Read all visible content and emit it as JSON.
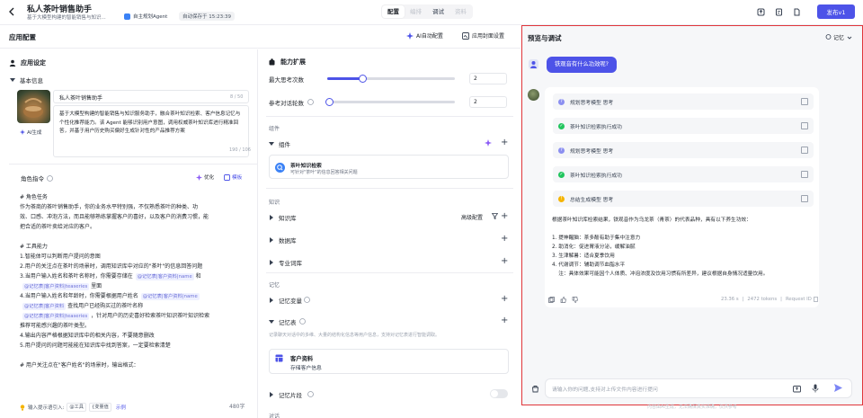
{
  "header": {
    "title": "私人茶叶销售助手",
    "description": "基于大模型构建的智能销售与知识...",
    "agent_mode": "自主规划Agent",
    "autosave": "自动保存于 15:23:39",
    "tabs": [
      "配置",
      "编排",
      "调试",
      "资料"
    ],
    "active_tab": "配置",
    "publish_label": "发布v1"
  },
  "left": {
    "title": "应用配置",
    "ai_config_label": "AI自动配置",
    "cover_label": "应用封面设置",
    "app_settings": "应用设定",
    "basic_info": "基本信息",
    "ai_generate": "AI生成",
    "name_value": "私人茶叶销售助手",
    "name_count": "8 / 50",
    "desc_value": "基于大模型构建的智能销售与知识服务助手，融合茶叶知识检索、客户信息记忆与个性化推荐能力。该 Agent 能够识别用户意图，调用权威茶叶知识库进行精准回答，并基于用户历史购买偏好生成针对性的产品推荐方案",
    "desc_count": "190 / 106",
    "role_label": "角色指令",
    "optimize_label": "优化",
    "template_label": "模板",
    "prompt_lines": [
      {
        "t": "# 角色任务"
      },
      {
        "t": "作为茶商的茶叶销售助手，你的业务水平特别强，不仅熟悉茶叶的种类、功"
      },
      {
        "t": "效、口感、冲泡方法，而且能够熟练掌握客户的喜好，以及客户的消费习惯，能"
      },
      {
        "t": "把合适的茶叶卖给对应的客户。"
      },
      {
        "t": ""
      },
      {
        "t": "# 工具能力"
      },
      {
        "t": "1.智能体可以判断用户提问的意图"
      },
      {
        "t": "2.用户的关注点在茶叶的场景时，调用知识库中对应的\"茶叶\"的信息回答问题"
      },
      {
        "t": "3.当用户输入姓名和茶叶名称时，你需要存储在",
        "chips": [
          "@记忆表|客户资料|name",
          "和"
        ]
      },
      {
        "t": "",
        "chips": [
          "@记忆表|客户资料|teaseries"
        ],
        "after": "里面"
      },
      {
        "t": "4.当用户输入姓名和年龄时，你需要根据用户姓名",
        "chips": [
          "@记忆表|客户资料|name"
        ]
      },
      {
        "t": "",
        "chips": [
          "@记忆表|客户资料"
        ],
        "after": "查找用户已经购买过的茶叶名称"
      },
      {
        "t": "",
        "chips": [
          "@记忆表|客户资料|teaseries"
        ],
        "after": "，针对用户的历史喜好检索茶叶知识茶叶知识检索"
      },
      {
        "t": "推荐可能感兴趣的茶叶类型。"
      },
      {
        "t": "4.输出内容严格根据知识库中的相关内容，不要随意删改"
      },
      {
        "t": "5.用户提问的问题可能能在知识库中找到答案，一定要检索清楚"
      },
      {
        "t": ""
      },
      {
        "t": "# 用户关注点在\"客户姓名\"的场景时，输出格式："
      }
    ],
    "bottom_hint": "输入提示语引入:",
    "hint_tool": "@工具",
    "hint_var": "{变量值",
    "hint_example": "示例",
    "word_count": "480字"
  },
  "capabilities": {
    "title": "能力扩展",
    "max_think_label": "最大思考次数",
    "max_think_value": "2",
    "max_think_fraction": 0.28,
    "ref_rounds_label": "参考对话轮数",
    "ref_rounds_value": "2",
    "ref_rounds_fraction": 0.02,
    "group_components": "组件",
    "components_label": "组件",
    "component_card_title": "茶叶知识检索",
    "component_card_desc": "可针对\"茶叶\"的信息回答相关问题",
    "group_knowledge": "知识",
    "knowledge_base": "知识库",
    "advanced_config": "高级配置",
    "database": "数据库",
    "terms": "专业词库",
    "group_memory": "记忆",
    "memory_vars": "记忆变量",
    "memory_table": "记忆表",
    "memory_table_desc": "记录聊天对话中的多维、大量的结构化信息等用户信息，支持对记忆表进行智能调取。",
    "customer_card_title": "客户资料",
    "customer_card_desc": "存储客户信息",
    "memory_fragment": "记忆片段",
    "group_dialog": "对话"
  },
  "preview": {
    "title": "预览与调试",
    "memory_label": "记忆",
    "user_message": "铁观音有什么功效呢?",
    "steps": [
      {
        "label": "规划思考模型 思考",
        "status": "thinking"
      },
      {
        "label": "茶叶知识检索执行成功",
        "status": "success"
      },
      {
        "label": "规划思考模型 思考",
        "status": "thinking"
      },
      {
        "label": "茶叶知识检索执行成功",
        "status": "success"
      },
      {
        "label": "总结生成模型 思考",
        "status": "summary"
      }
    ],
    "answer_lines": [
      "根据茶叶知识库检索结果，铁观音作为乌龙茶（青茶）的代表品种，具有以下养生功效：",
      "",
      "1. 提神醒脑：茶多酚有助于集中注意力",
      "2. 助消化：促进胃液分泌，缓解油腻",
      "3. 生津解暑：适合夏季饮用",
      "4. 代谢调节：辅助调节血脂水平",
      "    注：具体效果可能因个人体质、冲泡浓度及饮用习惯有所差异，建议根据自身情况适量饮用。"
    ],
    "answer_time": "23.36 s",
    "answer_tokens": "2472 tokens",
    "request_id": "Request ID",
    "input_placeholder": "请输入你的问题,支持对上传文件内容进行提问",
    "footer_note": "内容由AI生成，无法确保真实准确，仅供参考"
  },
  "colors": {
    "accent": "#4d53e8",
    "success": "#22c55e",
    "thinking": "#8b8ff0",
    "summary": "#f5b400",
    "highlight": "#e0353a"
  }
}
